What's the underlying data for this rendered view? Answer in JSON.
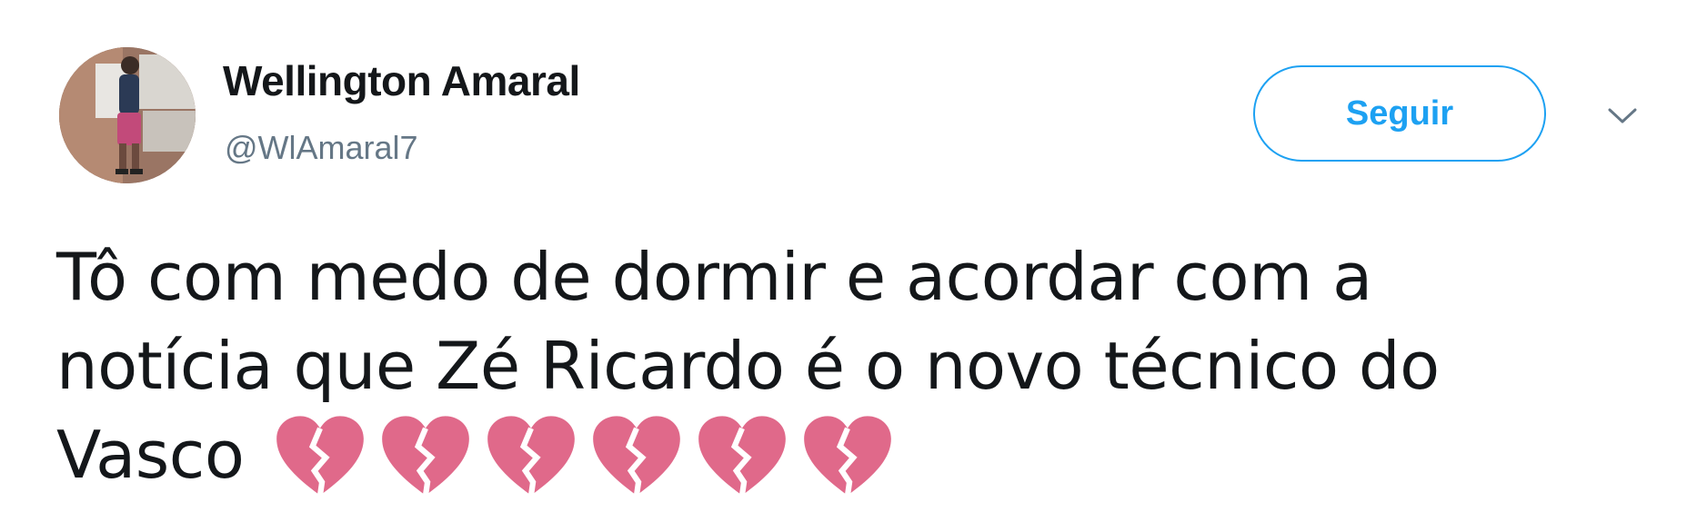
{
  "tweet": {
    "author": {
      "display_name": "Wellington Amaral",
      "username": "@WlAmaral7"
    },
    "follow_label": "Seguir",
    "text": "Tô com medo de dormir e acordar com a notícia que Zé Ricardo é o novo técnico do Vasco",
    "emoji": [
      "broken-heart",
      "broken-heart",
      "broken-heart",
      "broken-heart",
      "broken-heart",
      "broken-heart"
    ]
  },
  "colors": {
    "accent": "#1da1f2",
    "username": "#657786",
    "text": "#14171a",
    "heart": "#e0698a"
  },
  "icons": {
    "more_menu": "chevron-down-icon",
    "emoji": "broken-heart-icon"
  }
}
